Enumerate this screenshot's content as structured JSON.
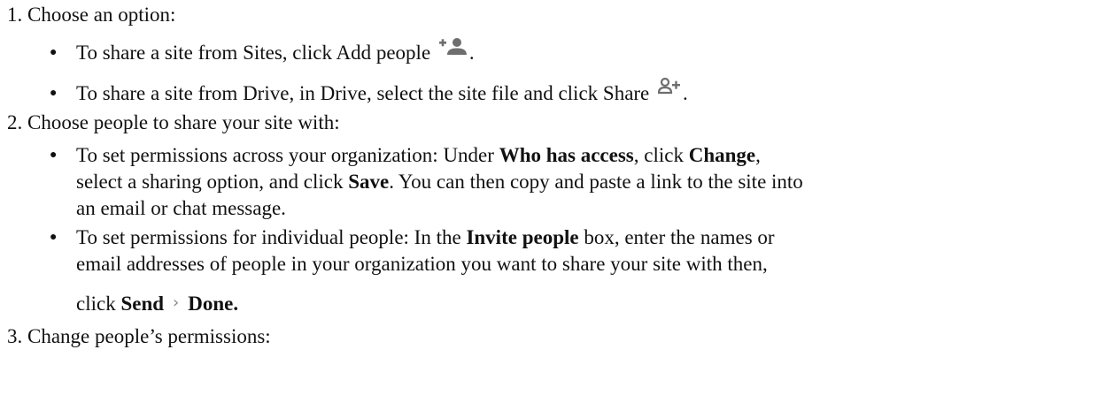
{
  "steps": [
    {
      "number": "1.",
      "title": "Choose an option:",
      "bullets": [
        {
          "text": "To share a site from Sites, click Add people",
          "icon": "add-person-icon",
          "tail": "."
        },
        {
          "text": "To share a site from Drive, in Drive, select the site file and click Share",
          "icon": "share-person-add-icon",
          "tail": "."
        }
      ]
    },
    {
      "number": "2.",
      "title": "Choose people to share your site with:",
      "bullets": [
        {
          "line1_a": "To set permissions across your organization: Under ",
          "line1_b1": "Who has access",
          "line1_c": ", click ",
          "line1_b2": "Change",
          "line1_d": ",",
          "line2_a": "select a sharing option, and click ",
          "line2_b": "Save",
          "line2_c": ". You can then copy and paste a link to the site into",
          "line3": "an email or chat message."
        },
        {
          "line1_a": "To set permissions for individual people: In the ",
          "line1_b": "Invite people",
          "line1_c": " box, enter the names or",
          "line2": "email addresses of people in your organization you want to share your site with then,",
          "line3_a": "click ",
          "line3_b1": "Send",
          "line3_chevron": "›",
          "line3_b2": "Done."
        }
      ]
    },
    {
      "number": "3.",
      "title": "Change people’s permissions:"
    }
  ],
  "bullet_glyph": "●",
  "icon_color": "#6e6e6e"
}
